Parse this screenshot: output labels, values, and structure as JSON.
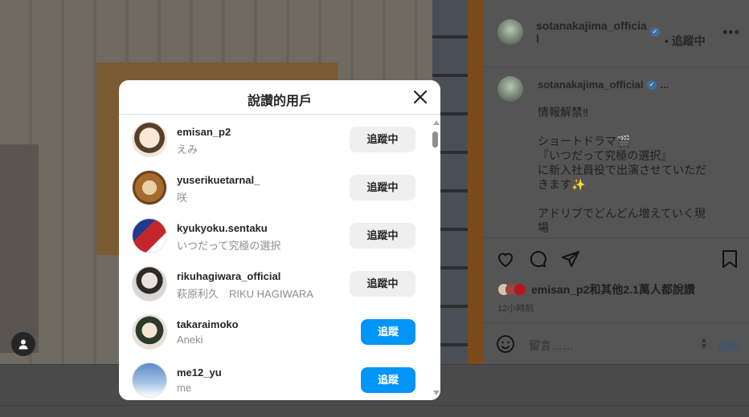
{
  "post": {
    "author_header": "sotanakajima_officia\nl",
    "header_follow_status": "• 追蹤中",
    "caption_author": "sotanakajima_official",
    "caption_ellipsis": "...",
    "caption": "情報解禁‼\n\nショートドラマ🎬\n『いつだって究極の選択』\nに新入社員役で出演させていただきます✨\n\nアドリブでどんどん増えていく現場",
    "liked_by": "emisan_p2和其他2.1萬人都說讚",
    "time": "12小時前",
    "comment_placeholder": "留言……",
    "post_button": "發佈"
  },
  "modal": {
    "title": "說讚的用戶",
    "users": [
      {
        "handle": "emisan_p2",
        "display": "えみ",
        "button": "追蹤中",
        "following": true,
        "avatar_color": "#f1e6d8"
      },
      {
        "handle": "yuserikuetarnal_",
        "display": "咲",
        "button": "追蹤中",
        "following": true,
        "avatar_color": "#b07a3c"
      },
      {
        "handle": "kyukyoku.sentaku",
        "display": "いつだって究極の選択",
        "button": "追蹤中",
        "following": true,
        "avatar_color": "#c4262d"
      },
      {
        "handle": "rikuhagiwara_official",
        "display": "萩原利久　RIKU HAGIWARA",
        "button": "追蹤中",
        "following": true,
        "avatar_color": "#d8d6d2"
      },
      {
        "handle": "takaraimoko",
        "display": "Aneki",
        "button": "追蹤",
        "following": false,
        "avatar_color": "#2c3a2a"
      },
      {
        "handle": "me12_yu",
        "display": "me",
        "button": "追蹤",
        "following": false,
        "avatar_color": "#8fb2d8"
      }
    ]
  }
}
